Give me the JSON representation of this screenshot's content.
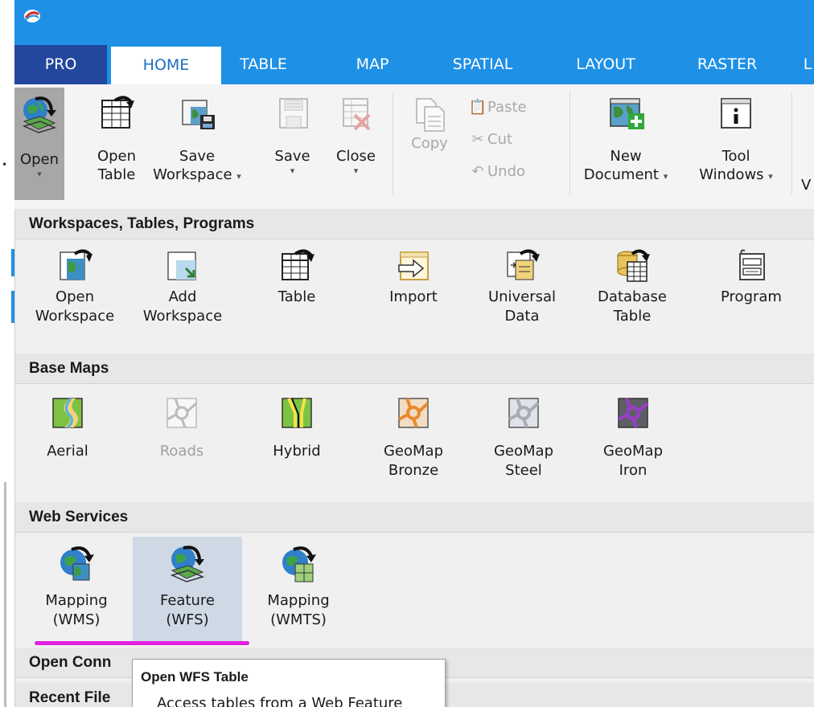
{
  "tabs": [
    {
      "label": "PRO"
    },
    {
      "label": "HOME"
    },
    {
      "label": "TABLE"
    },
    {
      "label": "MAP"
    },
    {
      "label": "SPATIAL"
    },
    {
      "label": "LAYOUT"
    },
    {
      "label": "RASTER"
    },
    {
      "label": "L"
    }
  ],
  "ribbon": {
    "open": {
      "label": "Open"
    },
    "open_table": {
      "line1": "Open",
      "line2": "Table"
    },
    "save_workspace": {
      "line1": "Save",
      "line2": "Workspace"
    },
    "save": {
      "label": "Save"
    },
    "close": {
      "label": "Close"
    },
    "copy": {
      "label": "Copy"
    },
    "paste": {
      "label": "Paste"
    },
    "cut": {
      "label": "Cut"
    },
    "undo": {
      "label": "Undo"
    },
    "new_document": {
      "line1": "New",
      "line2": "Document"
    },
    "tool_windows": {
      "line1": "Tool",
      "line2": "Windows"
    },
    "overflow": {
      "label": "V"
    },
    "dropdown_caret": "▾"
  },
  "sections": {
    "workspaces": {
      "title": "Workspaces, Tables, Programs",
      "items": [
        {
          "line1": "Open",
          "line2": "Workspace"
        },
        {
          "line1": "Add",
          "line2": "Workspace"
        },
        {
          "line1": "Table",
          "line2": ""
        },
        {
          "line1": "Import",
          "line2": ""
        },
        {
          "line1": "Universal",
          "line2": "Data"
        },
        {
          "line1": "Database",
          "line2": "Table"
        },
        {
          "line1": "Program",
          "line2": ""
        }
      ]
    },
    "basemaps": {
      "title": "Base Maps",
      "items": [
        {
          "line1": "Aerial",
          "line2": ""
        },
        {
          "line1": "Roads",
          "line2": ""
        },
        {
          "line1": "Hybrid",
          "line2": ""
        },
        {
          "line1": "GeoMap",
          "line2": "Bronze"
        },
        {
          "line1": "GeoMap",
          "line2": "Steel"
        },
        {
          "line1": "GeoMap",
          "line2": "Iron"
        }
      ]
    },
    "webservices": {
      "title": "Web Services",
      "items": [
        {
          "line1": "Mapping",
          "line2": "(WMS)"
        },
        {
          "line1": "Feature",
          "line2": "(WFS)"
        },
        {
          "line1": "Mapping",
          "line2": "(WMTS)"
        }
      ]
    },
    "open_connections": {
      "title": "Open Conn"
    },
    "recent_files": {
      "title": "Recent File"
    }
  },
  "tooltip": {
    "title": "Open WFS Table",
    "description": "Access tables from a Web Feature"
  },
  "colors": {
    "ribbon_blue": "#1e90e6",
    "pro_tab": "#23479c",
    "highlight_underline": "#e020e0",
    "selected_item": "#cfd9e6"
  }
}
